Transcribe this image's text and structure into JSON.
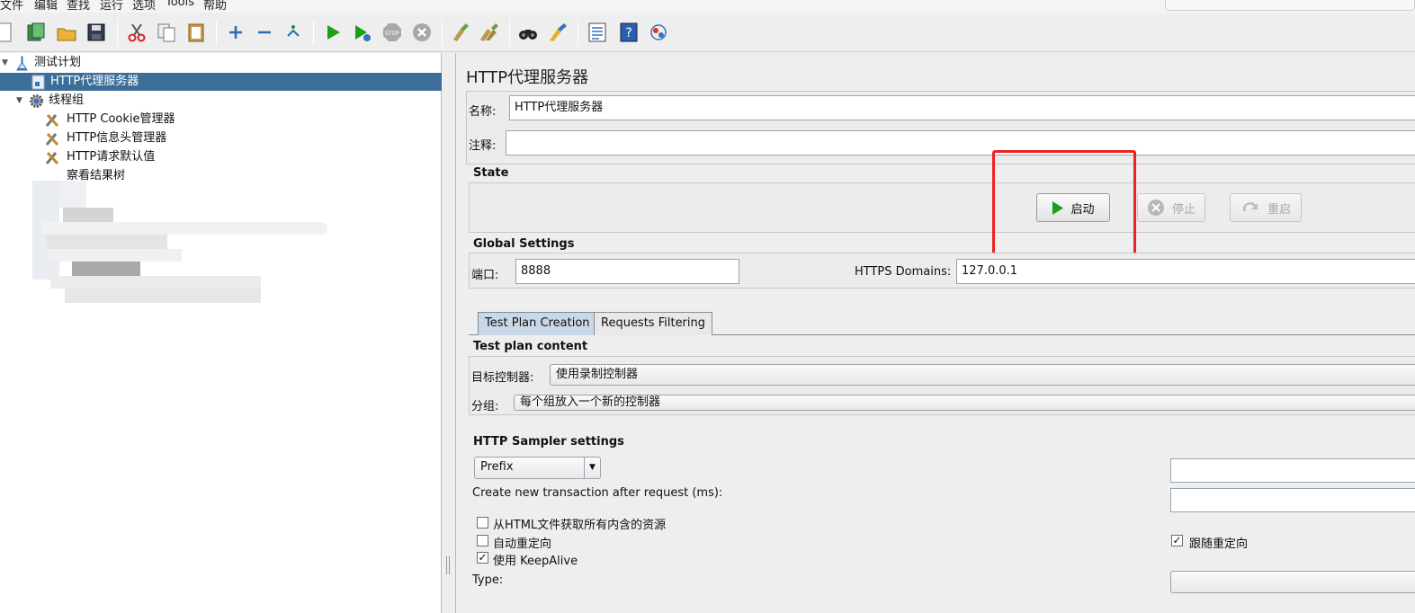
{
  "menu": [
    "文件",
    "编辑",
    "查找",
    "运行",
    "选项",
    "Tools",
    "帮助"
  ],
  "toolbar_icons": [
    "new-icon",
    "templates-icon",
    "open-icon",
    "save-icon",
    "cut-icon",
    "copy-icon",
    "paste-icon",
    "expand-icon",
    "collapse-icon",
    "toggle-icon",
    "start-icon",
    "start-no-pause-icon",
    "stop-icon",
    "shutdown-icon",
    "clear-icon",
    "clear-all-icon",
    "search-icon",
    "reset-search-icon",
    "function-helper-icon",
    "help-icon",
    "remote-icon"
  ],
  "tree": {
    "root": "测试计划",
    "proxy": "HTTP代理服务器",
    "thread_group": "线程组",
    "cookie_manager": "HTTP Cookie管理器",
    "header_manager": "HTTP信息头管理器",
    "request_defaults": "HTTP请求默认值",
    "results_tree": "察看结果树"
  },
  "panel": {
    "title": "HTTP代理服务器",
    "name_label": "名称:",
    "name_value": "HTTP代理服务器",
    "comment_label": "注释:",
    "comment_value": "",
    "state_header": "State",
    "start_label": "启动",
    "stop_label": "停止",
    "restart_label": "重启",
    "global_header": "Global Settings",
    "port_label": "端口:",
    "port_value": "8888",
    "https_label": "HTTPS Domains:",
    "https_value": "127.0.0.1",
    "tabs": [
      "Test Plan Creation",
      "Requests Filtering"
    ],
    "test_plan_content": "Test plan content",
    "target_label": "目标控制器:",
    "target_value": "使用录制控制器",
    "grouping_label": "分组:",
    "grouping_value": "每个组放入一个新的控制器",
    "sampler_header": "HTTP Sampler settings",
    "prefix_value": "Prefix",
    "prefix_input": "",
    "transaction_label": "Create new transaction after request (ms):",
    "transaction_value": "",
    "retrieve_resources": "从HTML文件获取所有内含的资源",
    "retrieve_checked": false,
    "auto_redirect": "自动重定向",
    "auto_redirect_checked": false,
    "keepalive": "使用 KeepAlive",
    "keepalive_checked": true,
    "follow_redirect": "跟随重定向",
    "follow_redirect_checked": true,
    "type_label": "Type:",
    "type_value": ""
  },
  "colors": {
    "selection": "#3d6e99",
    "highlight": "#ee2222",
    "tab_active": "#c9d8e6",
    "start_icon": "#18a018"
  }
}
